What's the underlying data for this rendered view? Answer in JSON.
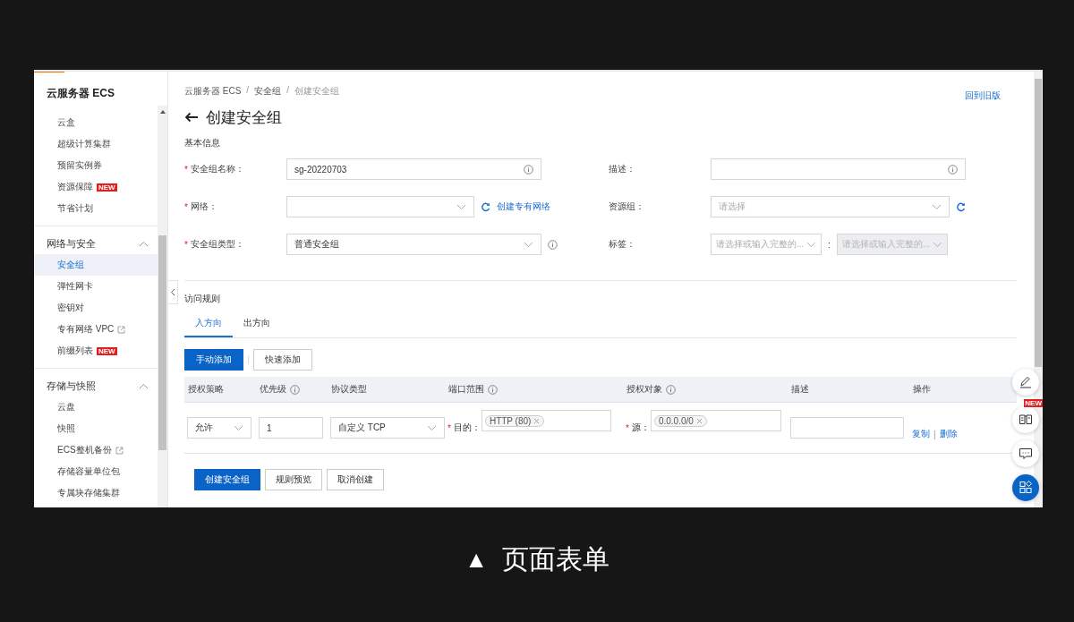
{
  "sidebar": {
    "title": "云服务器 ECS",
    "sections": [
      {
        "items": [
          {
            "label": "云盒",
            "selected": false
          },
          {
            "label": "超级计算集群",
            "selected": false
          },
          {
            "label": "预留实例券",
            "selected": false
          },
          {
            "label": "资源保障",
            "selected": false,
            "badge": "NEW"
          },
          {
            "label": "节省计划",
            "selected": false
          }
        ]
      },
      {
        "title": "网络与安全",
        "expanded": true,
        "items": [
          {
            "label": "安全组",
            "selected": true
          },
          {
            "label": "弹性网卡",
            "selected": false
          },
          {
            "label": "密钥对",
            "selected": false
          },
          {
            "label": "专有网络 VPC",
            "selected": false,
            "external": true
          },
          {
            "label": "前缀列表",
            "selected": false,
            "badge": "NEW"
          }
        ]
      },
      {
        "title": "存储与快照",
        "expanded": true,
        "items": [
          {
            "label": "云盘",
            "selected": false
          },
          {
            "label": "快照",
            "selected": false
          },
          {
            "label": "ECS整机备份",
            "selected": false,
            "external": true
          },
          {
            "label": "存储容量单位包",
            "selected": false
          },
          {
            "label": "专属块存储集群",
            "selected": false
          }
        ]
      }
    ]
  },
  "breadcrumb": [
    {
      "kind": "crumb",
      "text": "云服务器 ECS"
    },
    {
      "kind": "separator",
      "text": "/"
    },
    {
      "kind": "crumb",
      "text": "安全组"
    },
    {
      "kind": "separator",
      "text": "/"
    },
    {
      "kind": "current",
      "text": "创建安全组"
    }
  ],
  "old_version_link": "回到旧版",
  "title": "创建安全组",
  "basic_info": {
    "heading": "基本信息",
    "fields": [
      {
        "label": "安全组名称：",
        "required_mark": "*",
        "kind": "text",
        "value": "sg-20220703",
        "info": true
      },
      {
        "label": "描述：",
        "kind": "text",
        "info": true
      },
      {
        "label": "网络：",
        "required_mark": "*",
        "kind": "select",
        "refresh": true,
        "link": "创建专有网络"
      },
      {
        "label": "资源组：",
        "kind": "select",
        "placeholder": "请选择",
        "refresh": true
      },
      {
        "label": "安全组类型：",
        "required_mark": "*",
        "kind": "select",
        "value": "普通安全组",
        "info": true
      },
      {
        "label": "标签：",
        "kind": "tags",
        "separator": ":",
        "selects": [
          {
            "placeholder": "请选择或输入完整的...",
            "disabled": false
          },
          {
            "placeholder": "请选择或输入完整的...",
            "disabled": true
          }
        ]
      }
    ]
  },
  "access_rules": {
    "heading": "访问规则",
    "tabs": [
      {
        "label": "入方向",
        "selected": true
      },
      {
        "label": "出方向",
        "selected": false
      }
    ],
    "buttons": [
      {
        "label": "手动添加",
        "primary": true
      },
      {
        "label": "快速添加",
        "primary": false
      }
    ],
    "table": {
      "columns": [
        {
          "label": "授权策略"
        },
        {
          "label": "优先级",
          "info": true
        },
        {
          "label": "协议类型"
        },
        {
          "label": "端口范围",
          "info": true
        },
        {
          "label": "授权对象",
          "info": true
        },
        {
          "label": "描述"
        },
        {
          "label": "操作"
        }
      ],
      "rows": [
        {
          "policy": "允许",
          "priority": "1",
          "protocol": "自定义 TCP",
          "port": {
            "label": "目的：",
            "required_mark": "*",
            "tags": [
              "HTTP (80)"
            ]
          },
          "target": {
            "label": "源：",
            "required_mark": "*",
            "tags": [
              "0.0.0.0/0"
            ]
          },
          "actions": [
            {
              "kind": "link",
              "text": "复制"
            },
            {
              "kind": "separator",
              "text": "|"
            },
            {
              "kind": "link",
              "text": "删除"
            }
          ]
        }
      ]
    }
  },
  "footer_buttons": [
    {
      "label": "创建安全组",
      "primary": true
    },
    {
      "label": "规则预览",
      "primary": false
    },
    {
      "label": "取消创建",
      "primary": false
    }
  ],
  "floating_buttons": [
    {
      "kind": "edit",
      "primary": false
    },
    {
      "kind": "book",
      "primary": false,
      "badge": "NEW"
    },
    {
      "kind": "chat",
      "primary": false
    },
    {
      "kind": "apps",
      "primary": true
    }
  ],
  "caption": {
    "icon": "▲",
    "text": "页面表单"
  }
}
